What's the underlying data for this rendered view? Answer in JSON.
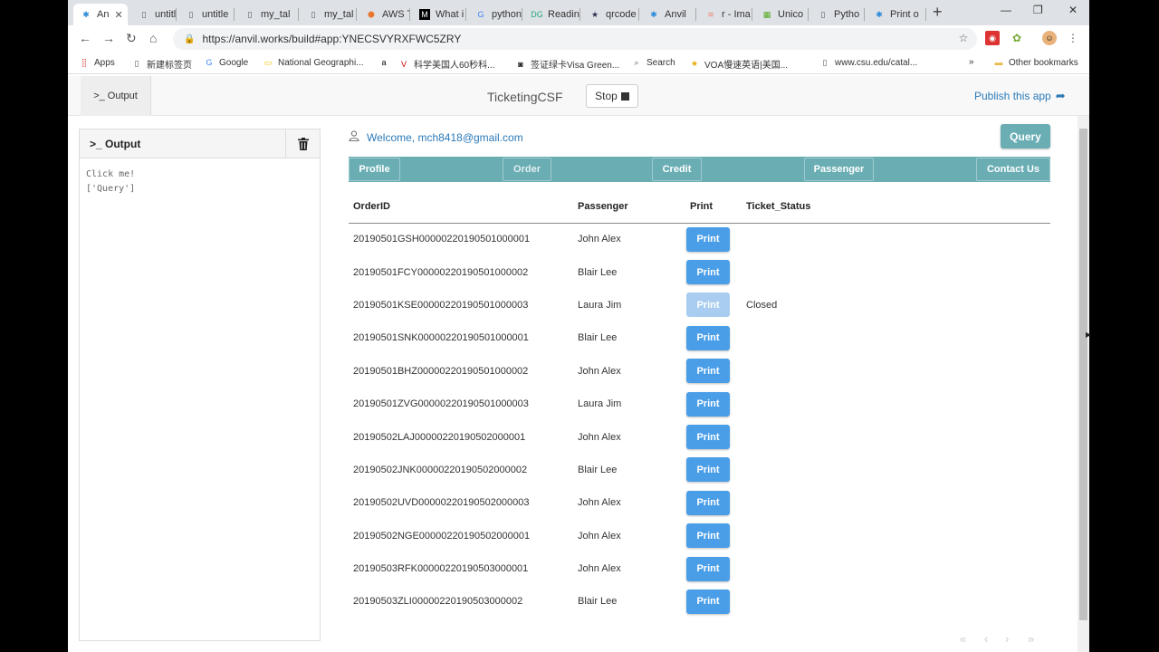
{
  "browser": {
    "tabs": [
      {
        "title": "An",
        "icon": "anvil-icon",
        "active": true
      },
      {
        "title": "untitle",
        "icon": "document-icon"
      },
      {
        "title": "untitle",
        "icon": "document-icon"
      },
      {
        "title": "my_tal",
        "icon": "document-icon"
      },
      {
        "title": "my_tal",
        "icon": "document-icon"
      },
      {
        "title": "AWS T",
        "icon": "aws-icon"
      },
      {
        "title": "What i",
        "icon": "medium-icon"
      },
      {
        "title": "python",
        "icon": "google-icon"
      },
      {
        "title": "Readin",
        "icon": "dg-icon"
      },
      {
        "title": "qrcode",
        "icon": "star-icon"
      },
      {
        "title": "Anvil",
        "icon": "anvil-icon"
      },
      {
        "title": "r - Ima",
        "icon": "stack-icon"
      },
      {
        "title": "Unico",
        "icon": "book-icon"
      },
      {
        "title": "Pytho",
        "icon": "document-icon"
      },
      {
        "title": "Print o",
        "icon": "anvil-icon"
      }
    ],
    "url": "https://anvil.works/build#app:YNECSVYRXFWC5ZRY",
    "bookmarks": [
      {
        "label": "Apps",
        "icon": "apps-icon"
      },
      {
        "label": "新建标签页",
        "icon": "document-icon"
      },
      {
        "label": "Google",
        "icon": "google-icon"
      },
      {
        "label": "National Geographi...",
        "icon": "natgeo-icon"
      },
      {
        "label": "",
        "icon": "amazon-icon"
      },
      {
        "label": "科学美国人60秒科...",
        "icon": "voa-icon"
      },
      {
        "label": "签证绿卡Visa Green...",
        "icon": "visa-icon"
      },
      {
        "label": "Search",
        "icon": "search-icon"
      },
      {
        "label": "VOA慢速英语|美国...",
        "icon": "star-icon"
      },
      {
        "label": "www.csu.edu/catal...",
        "icon": "document-icon"
      },
      {
        "label": "Other bookmarks",
        "icon": "folder-icon"
      }
    ]
  },
  "anvil": {
    "output_tab": ">_ Output",
    "app_title": "TicketingCSF",
    "stop_label": "Stop",
    "publish_label": "Publish this app"
  },
  "output_panel": {
    "title": ">_ Output",
    "lines": "Click me!\n['Query']"
  },
  "main": {
    "welcome": "Welcome, mch8418@gmail.com",
    "query_label": "Query",
    "nav": [
      "Profile",
      "Order",
      "Credit",
      "Passenger",
      "Contact Us"
    ],
    "columns": [
      "OrderID",
      "Passenger",
      "Print",
      "Ticket_Status"
    ],
    "print_label": "Print",
    "rows": [
      {
        "order_id": "20190501GSH00000220190501000001",
        "passenger": "John Alex",
        "print_enabled": true,
        "status": ""
      },
      {
        "order_id": "20190501FCY00000220190501000002",
        "passenger": "Blair Lee",
        "print_enabled": true,
        "status": ""
      },
      {
        "order_id": "20190501KSE00000220190501000003",
        "passenger": "Laura Jim",
        "print_enabled": false,
        "status": "Closed"
      },
      {
        "order_id": "20190501SNK00000220190501000001",
        "passenger": "Blair Lee",
        "print_enabled": true,
        "status": ""
      },
      {
        "order_id": "20190501BHZ00000220190501000002",
        "passenger": "John Alex",
        "print_enabled": true,
        "status": ""
      },
      {
        "order_id": "20190501ZVG00000220190501000003",
        "passenger": "Laura Jim",
        "print_enabled": true,
        "status": ""
      },
      {
        "order_id": "20190502LAJ00000220190502000001",
        "passenger": "John Alex",
        "print_enabled": true,
        "status": ""
      },
      {
        "order_id": "20190502JNK00000220190502000002",
        "passenger": "Blair Lee",
        "print_enabled": true,
        "status": ""
      },
      {
        "order_id": "20190502UVD00000220190502000003",
        "passenger": "John Alex",
        "print_enabled": true,
        "status": ""
      },
      {
        "order_id": "20190502NGE00000220190502000001",
        "passenger": "John Alex",
        "print_enabled": true,
        "status": ""
      },
      {
        "order_id": "20190503RFK00000220190503000001",
        "passenger": "John Alex",
        "print_enabled": true,
        "status": ""
      },
      {
        "order_id": "20190503ZLI00000220190503000002",
        "passenger": "Blair Lee",
        "print_enabled": true,
        "status": ""
      }
    ],
    "pager": [
      "«",
      "‹",
      "›",
      "»"
    ]
  },
  "colors": {
    "accent": "#6aaeb4",
    "print_button": "#4a9ee8",
    "print_button_disabled": "#a8cdf0",
    "link": "#2a7ab8"
  }
}
